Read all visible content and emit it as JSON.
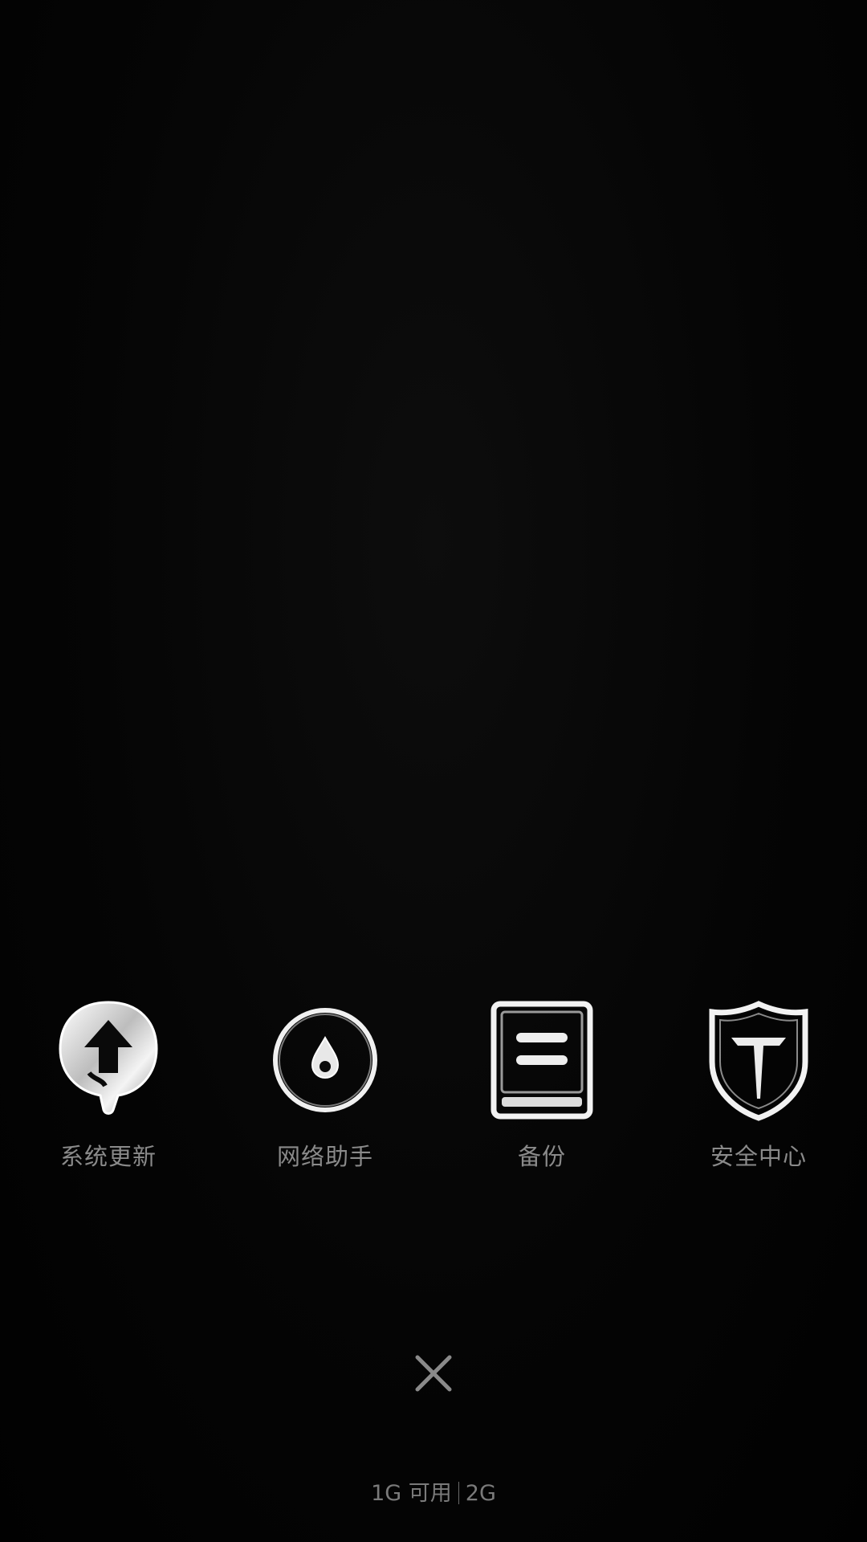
{
  "apps": [
    {
      "label": "系统更新",
      "icon": "system-update-icon"
    },
    {
      "label": "网络助手",
      "icon": "network-assistant-icon"
    },
    {
      "label": "备份",
      "icon": "backup-icon"
    },
    {
      "label": "安全中心",
      "icon": "security-center-icon"
    }
  ],
  "close": {
    "icon": "close-icon"
  },
  "memory": {
    "available": "1G 可用",
    "total": "2G"
  },
  "colors": {
    "background": "#020202",
    "label": "#8a8a8a",
    "icon_chrome": "#e6e6e6"
  }
}
